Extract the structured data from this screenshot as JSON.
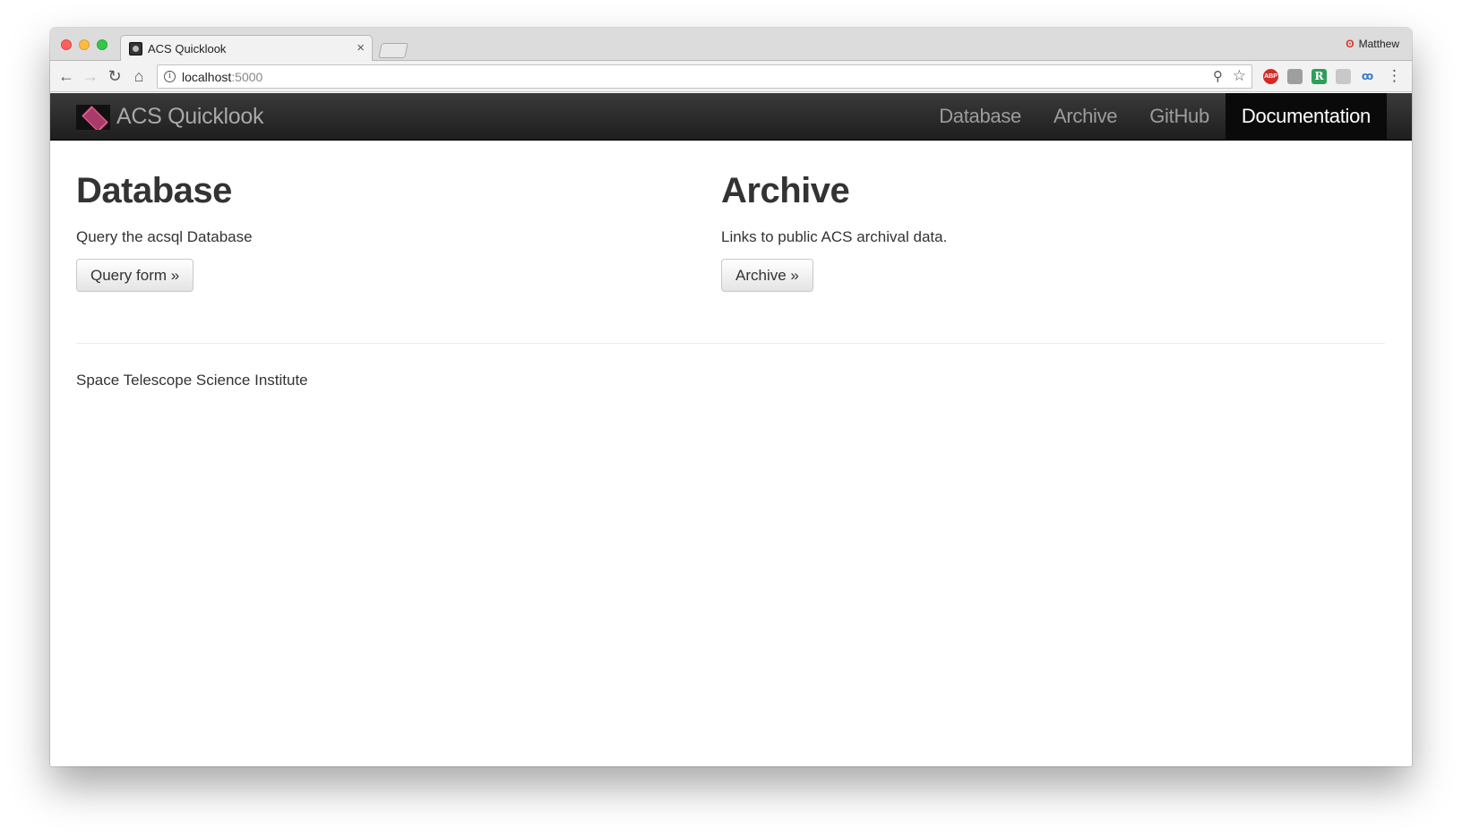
{
  "browser": {
    "tab_title": "ACS Quicklook",
    "tab_close": "×",
    "profile_name": "Matthew",
    "url_host": "localhost",
    "url_port": ":5000",
    "icons": {
      "back": "←",
      "forward": "→",
      "reload": "↻",
      "home": "⌂",
      "info": "i",
      "zoom": "⚲",
      "star": "☆",
      "menu": "⋮",
      "profile": "ʘ"
    },
    "extensions": {
      "abp": "ABP",
      "r": "R",
      "owl": "ꚙ"
    }
  },
  "navbar": {
    "brand": "ACS Quicklook",
    "links": [
      "Database",
      "Archive",
      "GitHub",
      "Documentation"
    ],
    "active_link": "Documentation"
  },
  "main": {
    "database": {
      "heading": "Database",
      "description": "Query the acsql Database",
      "button": "Query form »"
    },
    "archive": {
      "heading": "Archive",
      "description": "Links to public ACS archival data.",
      "button": "Archive »"
    }
  },
  "footer": {
    "text": "Space Telescope Science Institute"
  }
}
